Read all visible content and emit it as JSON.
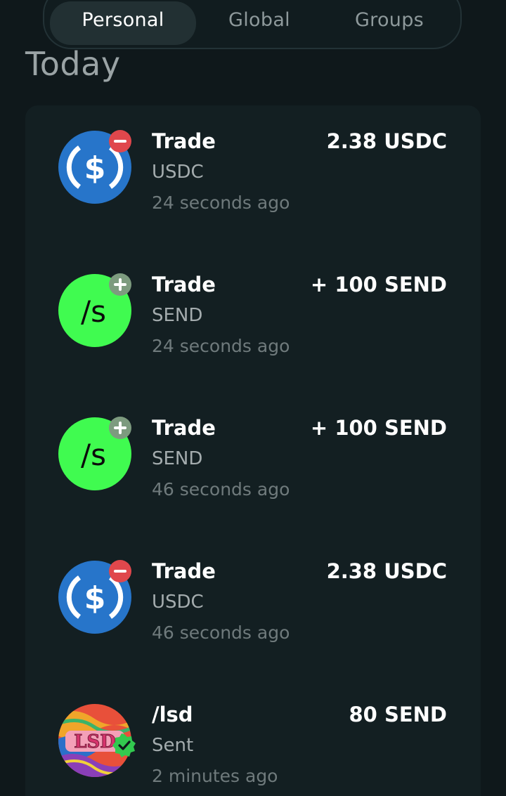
{
  "tabs": [
    {
      "label": "Personal",
      "active": true
    },
    {
      "label": "Global",
      "active": false
    },
    {
      "label": "Groups",
      "active": false
    }
  ],
  "section_title": "Today",
  "activities": [
    {
      "icon": "usdc-icon",
      "badge": "minus-badge-icon",
      "title": "Trade",
      "subtitle": "USDC",
      "time": "24 seconds ago",
      "amount": "2.38 USDC"
    },
    {
      "icon": "send-token-icon",
      "badge": "plus-badge-icon",
      "title": "Trade",
      "subtitle": "SEND",
      "time": "24 seconds ago",
      "amount": "+ 100 SEND"
    },
    {
      "icon": "send-token-icon",
      "badge": "plus-badge-icon",
      "title": "Trade",
      "subtitle": "SEND",
      "time": "46 seconds ago",
      "amount": "+ 100 SEND"
    },
    {
      "icon": "usdc-icon",
      "badge": "minus-badge-icon",
      "title": "Trade",
      "subtitle": "USDC",
      "time": "46 seconds ago",
      "amount": "2.38 USDC"
    },
    {
      "icon": "lsd-avatar-icon",
      "badge": "verified-check-icon",
      "title": "/lsd",
      "subtitle": "Sent",
      "time": "2 minutes ago",
      "amount": "80 SEND",
      "avatar_text": "LSD"
    }
  ],
  "icon_glyphs": {
    "send": "/s",
    "usdc": "$"
  },
  "colors": {
    "background": "#0f181b",
    "card": "#131f22",
    "usdc_blue": "#2775ca",
    "send_green": "#40fb50",
    "minus_red": "#e0474c",
    "plus_gray": "#7d9b7f",
    "verified_green": "#32c94f"
  }
}
